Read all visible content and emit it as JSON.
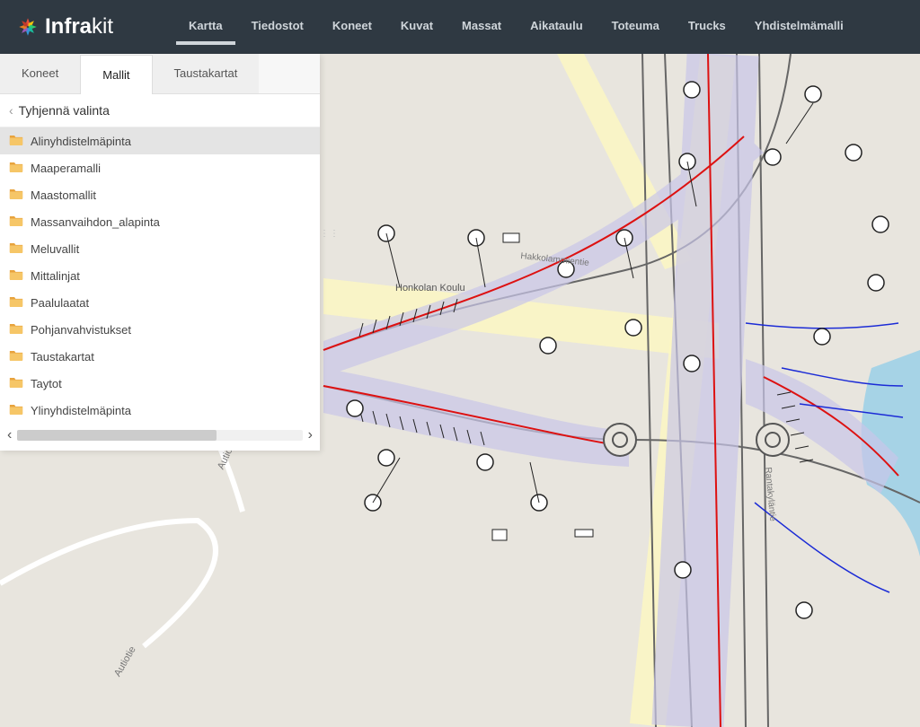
{
  "brand": {
    "name_strong": "Infra",
    "name_light": "kit"
  },
  "nav": {
    "items": [
      {
        "label": "Kartta",
        "active": true
      },
      {
        "label": "Tiedostot",
        "active": false
      },
      {
        "label": "Koneet",
        "active": false
      },
      {
        "label": "Kuvat",
        "active": false
      },
      {
        "label": "Massat",
        "active": false
      },
      {
        "label": "Aikataulu",
        "active": false
      },
      {
        "label": "Toteuma",
        "active": false
      },
      {
        "label": "Trucks",
        "active": false
      },
      {
        "label": "Yhdistelmämalli",
        "active": false
      }
    ]
  },
  "sidebar": {
    "tabs": [
      {
        "label": "Koneet",
        "active": false
      },
      {
        "label": "Mallit",
        "active": true
      },
      {
        "label": "Taustakartat",
        "active": false
      }
    ],
    "clear_label": "Tyhjennä valinta",
    "items": [
      {
        "label": "Alinyhdistelmäpinta",
        "selected": true
      },
      {
        "label": "Maaperamalli",
        "selected": false
      },
      {
        "label": "Maastomallit",
        "selected": false
      },
      {
        "label": "Massanvaihdon_alapinta",
        "selected": false
      },
      {
        "label": "Meluvallit",
        "selected": false
      },
      {
        "label": "Mittalinjat",
        "selected": false
      },
      {
        "label": "Paalulaatat",
        "selected": false
      },
      {
        "label": "Pohjanvahvistukset",
        "selected": false
      },
      {
        "label": "Taustakartat",
        "selected": false
      },
      {
        "label": "Taytot",
        "selected": false
      },
      {
        "label": "Ylinyhdistelmäpinta",
        "selected": false
      }
    ]
  },
  "map": {
    "labels": {
      "autiotie": "Autiotie",
      "honkola_koulu": "Honkolan Koulu",
      "hakkolammientie": "Hakkolammientie",
      "rantakylan": "Rantakyläntie"
    }
  }
}
